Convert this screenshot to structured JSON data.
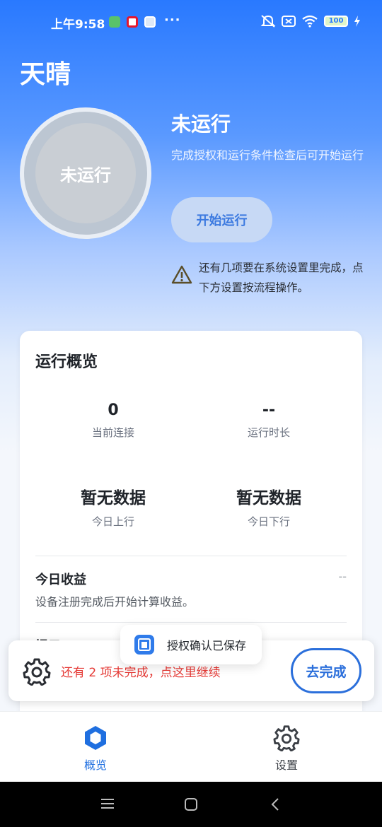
{
  "status_bar": {
    "time": "上午9:58",
    "more": "···",
    "battery": "100"
  },
  "header": {
    "title": "天晴"
  },
  "run_status": {
    "ring_label": "未运行",
    "title": "未运行",
    "description": "完成授权和运行条件检查后可开始运行",
    "start_button": "开始运行",
    "warning": "还有几项要在系统设置里完成，点下方设置按流程操作。"
  },
  "overview": {
    "title": "运行概览",
    "stats": [
      {
        "value": "0",
        "label": "当前连接"
      },
      {
        "value": "--",
        "label": "运行时长"
      },
      {
        "value": "暂无数据",
        "label": "今日上行"
      },
      {
        "value": "暂无数据",
        "label": "今日下行"
      }
    ],
    "earnings": {
      "title": "今日收益",
      "value": "--",
      "description": "设备注册完成后开始计算收益。"
    },
    "next_title": "提示"
  },
  "toast": {
    "text": "授权确认已保存"
  },
  "pending_banner": {
    "text": "还有 2 项未完成，点这里继续",
    "button": "去完成"
  },
  "bottom_nav": {
    "items": [
      {
        "label": "概览",
        "icon": "hexagon-icon",
        "active": true
      },
      {
        "label": "设置",
        "icon": "gear-icon",
        "active": false
      }
    ]
  },
  "colors": {
    "accent": "#2979ff",
    "warning_text": "#e53935",
    "active_nav": "#1f6fe0"
  }
}
